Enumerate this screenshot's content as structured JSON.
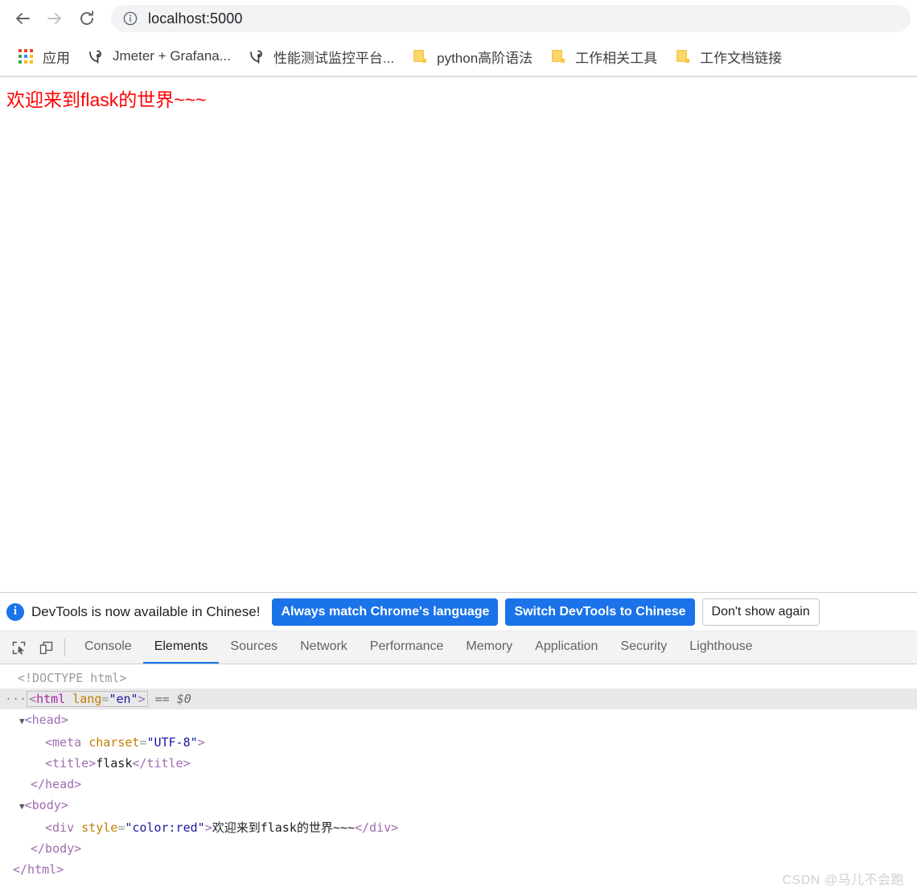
{
  "browser": {
    "nav": {
      "back_label": "Back",
      "forward_label": "Forward",
      "reload_label": "Reload"
    },
    "omnibox": {
      "site_info_icon": "info-circle-icon",
      "url": "localhost:5000"
    },
    "bookmarks": [
      {
        "icon": "apps-grid-icon",
        "label": "应用"
      },
      {
        "icon": "jmeter-icon",
        "label": "Jmeter + Grafana..."
      },
      {
        "icon": "jmeter-icon",
        "label": "性能测试监控平台..."
      },
      {
        "icon": "folder-icon",
        "label": "python高阶语法"
      },
      {
        "icon": "folder-icon",
        "label": "工作相关工具"
      },
      {
        "icon": "folder-icon",
        "label": "工作文档链接"
      }
    ]
  },
  "page": {
    "heading": "欢迎来到flask的世界~~~",
    "heading_color": "#ff0000"
  },
  "devtools": {
    "banner": {
      "icon": "info-icon",
      "message": "DevTools is now available in Chinese!",
      "primary_button_1": "Always match Chrome's language",
      "primary_button_2": "Switch DevTools to Chinese",
      "secondary_button": "Don't show again",
      "accent_color": "#1a73e8"
    },
    "toolbar_icons": [
      {
        "name": "inspect-element-icon"
      },
      {
        "name": "device-toolbar-icon"
      }
    ],
    "tabs": [
      {
        "label": "Console",
        "active": false
      },
      {
        "label": "Elements",
        "active": true
      },
      {
        "label": "Sources",
        "active": false
      },
      {
        "label": "Network",
        "active": false
      },
      {
        "label": "Performance",
        "active": false
      },
      {
        "label": "Memory",
        "active": false
      },
      {
        "label": "Application",
        "active": false
      },
      {
        "label": "Security",
        "active": false
      },
      {
        "label": "Lighthouse",
        "active": false
      }
    ],
    "dom_tree": {
      "doctype": "<!DOCTYPE html>",
      "html_open_prefix": "···",
      "html_tag_open": "<",
      "html_tag_name": "html",
      "html_attr_name": "lang",
      "html_attr_value": "\"en\"",
      "html_tag_close": ">",
      "html_selection_marker": "== $0",
      "head_open": "<head>",
      "meta_tag": "<meta",
      "meta_attr_name": "charset",
      "meta_attr_value": "\"UTF-8\"",
      "meta_close": ">",
      "title_open": "<title>",
      "title_text": "flask",
      "title_close": "</title>",
      "head_close": "</head>",
      "body_open": "<body>",
      "div_open": "<div",
      "div_attr_name": "style",
      "div_attr_value": "\"color:red\"",
      "div_gt": ">",
      "div_text": "欢迎来到flask的世界~~~",
      "div_close": "</div>",
      "body_close": "</body>",
      "html_close": "</html>",
      "expand_triangle": "▼"
    }
  },
  "watermark": "CSDN @马儿不会跑"
}
